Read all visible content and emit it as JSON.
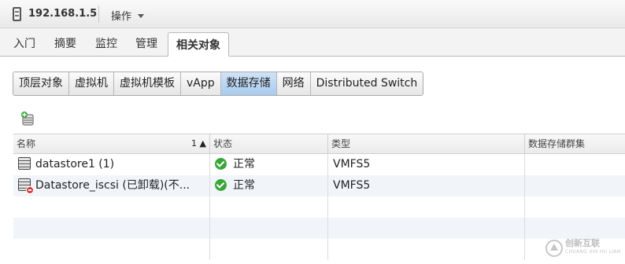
{
  "header": {
    "host": "192.168.1.5",
    "actions_label": "操作"
  },
  "tabs": [
    "入门",
    "摘要",
    "监控",
    "管理",
    "相关对象"
  ],
  "active_tab": "相关对象",
  "subtabs": [
    "顶层对象",
    "虚拟机",
    "虚拟机模板",
    "vApp",
    "数据存储",
    "网络",
    "Distributed Switch"
  ],
  "active_subtab": "数据存储",
  "table": {
    "columns": [
      "名称",
      "状态",
      "类型",
      "数据存储群集"
    ],
    "sort_indicator": "1 ▲",
    "rows": [
      {
        "name": "datastore1 (1)",
        "status": "正常",
        "type": "VMFS5",
        "cluster": ""
      },
      {
        "name": "Datastore_iscsi (已卸载)(不...",
        "status": "正常",
        "type": "VMFS5",
        "cluster": ""
      }
    ]
  },
  "watermark": {
    "text": "创新互联",
    "sub": "CHUANG XIN HU LIAN"
  }
}
